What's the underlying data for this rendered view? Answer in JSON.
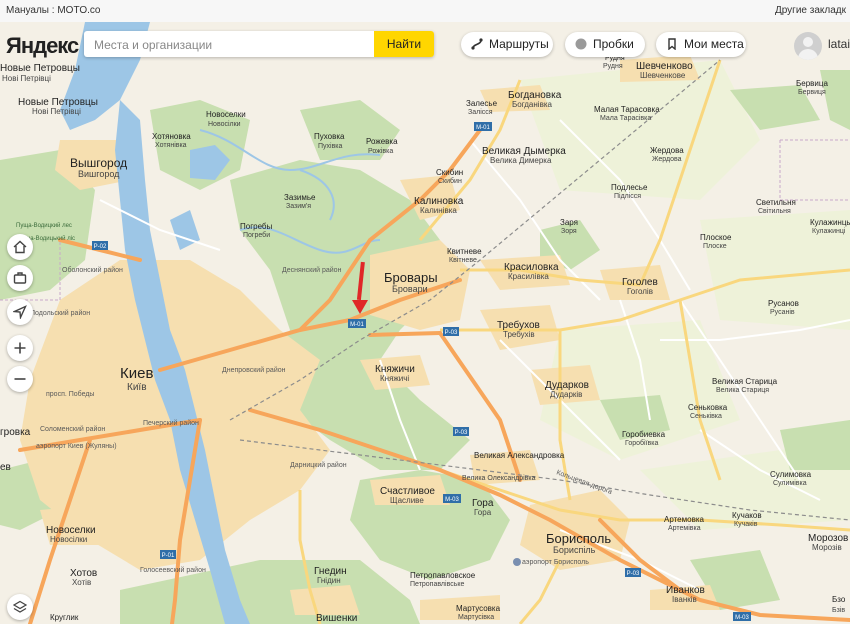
{
  "browser": {
    "bookmark_left": "Мануалы : MOTO.co",
    "bookmark_right": "Другие закладк"
  },
  "header": {
    "logo": "Яндекс",
    "search_placeholder": "Места и организации",
    "find_button": "Найти",
    "routes": "Маршруты",
    "traffic": "Пробки",
    "my_places": "Мои места",
    "user": "latai"
  },
  "controls": [
    "home-icon",
    "briefcase-icon",
    "locate-icon",
    "zoom-in-icon",
    "zoom-out-icon",
    "layers-icon"
  ],
  "colors": {
    "forest": "#c8dfb0",
    "urban": "#f6dfb0",
    "water": "#9dc6e6",
    "highway": "#f7a65b",
    "marker": "#e02828"
  },
  "road_labels": {
    "m01_a": "M-01",
    "m01_b": "M-01",
    "p02": "P-02",
    "p03_a": "P-03",
    "p03_b": "P-03",
    "p03_c": "P-03",
    "m03_a": "M-03",
    "m03_b": "M-03",
    "p01": "P-01"
  },
  "places": {
    "novye_petrovcy_top": "Новые Петровцы",
    "novye_petrovcy_top_ua": "Нові Петрівці",
    "novye_petrovcy": "Новые Петровцы",
    "novye_petrovcy_ua": "Нові Петрівці",
    "vyshgorod": "Вышгород",
    "vyshgorod_ua": "Вишгород",
    "hotyanovka": "Хотяновка",
    "hotyanovka_ua": "Хотянівка",
    "novoselki_top": "Новоселки",
    "novoselki_top_ua": "Новосілки",
    "puhovka": "Пуховка",
    "puhovka_ua": "Пухівка",
    "rozhevka": "Рожевка",
    "rozhevka_ua": "Рожівка",
    "zalesye": "Залесье",
    "zalesye_ua": "Залісся",
    "bogdanovka": "Богдановка",
    "bogdanovka_ua": "Богданівка",
    "malaya_tarasovka": "Малая Тарасовка",
    "malaya_tarasovka_ua": "Мала Тарасівка",
    "shevchenkovo": "Шевченково",
    "shevchenkovo_ua": "Шевченкове",
    "rudnya": "Рудня",
    "rudnya_ua": "Рудня",
    "berviza": "Бервица",
    "berviza_ua": "Бервиця",
    "velikaya_dymerka": "Великая Дымерка",
    "velikaya_dymerka_ua": "Велика Димерка",
    "zhedrovo": "Жердова",
    "zhedrovo_ua": "Жердова",
    "skibin": "Скибин",
    "skibin_ua": "Скибин",
    "zazimye": "Зазимье",
    "zazimye_ua": "Зазим'я",
    "kalinovka": "Калиновка",
    "kalinovka_ua": "Калинівка",
    "podlesye": "Подлесье",
    "podlesye_ua": "Підлісся",
    "svetilnya": "Светильня",
    "svetilnya_ua": "Світильня",
    "kulazhintsy": "Кулажинцы",
    "kulazhintsy_ua": "Кулажинці",
    "pushcha": "Пуща-Водицкий лес",
    "pushcha_ua": "Пуща-Водицький ліс",
    "pogreby": "Погребы",
    "pogreby_ua": "Погреби",
    "zarya": "Заря",
    "zarya_ua": "Зоря",
    "ploskoe": "Плоское",
    "ploskoe_ua": "Плоске",
    "kvitneve": "Квитневе",
    "kvitneve_ua": "Квітневе",
    "desnyansky": "Деснянский район",
    "brovary": "Бровары",
    "brovary_ua": "Бровари",
    "krasilovka": "Красиловка",
    "krasilovka_ua": "Красилівка",
    "gogolev": "Гоголев",
    "gogolev_ua": "Гоголів",
    "obolonsky": "Оболонский район",
    "rusanov": "Русанов",
    "rusanov_ua": "Русанів",
    "podolsky": "Подольский район",
    "trebuhov": "Требухов",
    "trebuhov_ua": "Требухів",
    "kiev": "Киев",
    "kiev_ua": "Київ",
    "dneprovsky": "Днепровский район",
    "knyazhichi": "Княжичи",
    "knyazhichi_ua": "Княжичі",
    "dudarkov": "Дударков",
    "dudarkov_ua": "Дударків",
    "velikaya_staritsa": "Великая Старица",
    "velikaya_staritsa_ua": "Велика Стариця",
    "senkovka": "Сеньковка",
    "senkovka_ua": "Сеньківка",
    "prospect_pobedy": "просп. Победы",
    "pechersky": "Печерский район",
    "solomensky": "Соломенский район",
    "gorobievka": "Горобиевка",
    "gorobievka_ua": "Горобіївка",
    "airport_zhulyany": "аэропорт Киев (Жуляны)",
    "darnitsky": "Дарницкий район",
    "velikaya_aleksandrovka": "Великая Александровка",
    "velikaya_aleksandrovka_ua": "Велика Олександрівка",
    "sulimovka": "Сулимовка",
    "sulimovka_ua": "Сулимівка",
    "schastlivoe": "Счастливое",
    "schastlivoe_ua": "Щасливе",
    "gora": "Гора",
    "gora_ua": "Гора",
    "koltsevaya": "Кольцевая дорога",
    "artemovka": "Артемовка",
    "artemovka_ua": "Артемівка",
    "kuchakov": "Кучаков",
    "kuchakov_ua": "Кучаків",
    "novoselki": "Новоселки",
    "novoselki_ua": "Новосілки",
    "borispol": "Борисполь",
    "borispol_ua": "Бориспіль",
    "morozovka": "Морозов",
    "morozovka_ua": "Морозів",
    "airport_borispol": "аэропорт Борисполь",
    "goloseevsky": "Голосеевский район",
    "gnedin": "Гнедин",
    "gnedin_ua": "Гнідин",
    "hotov": "Хотов",
    "hotov_ua": "Хотів",
    "petropavlovskoe": "Петропавловское",
    "petropavlovskoe_ua": "Петропавлівське",
    "ivankov": "Иванков",
    "ivankov_ua": "Іванків",
    "martusovka": "Мартусовка",
    "martusovka_ua": "Мартусівка",
    "vishenki": "Вишенки",
    "kruglik": "Круглик",
    "kruglik_ua": "Круглик",
    "bezo": "Бзо",
    "bezo_ua": "Бзів",
    "grobka": "гровка",
    "lev_edge": "ев"
  }
}
